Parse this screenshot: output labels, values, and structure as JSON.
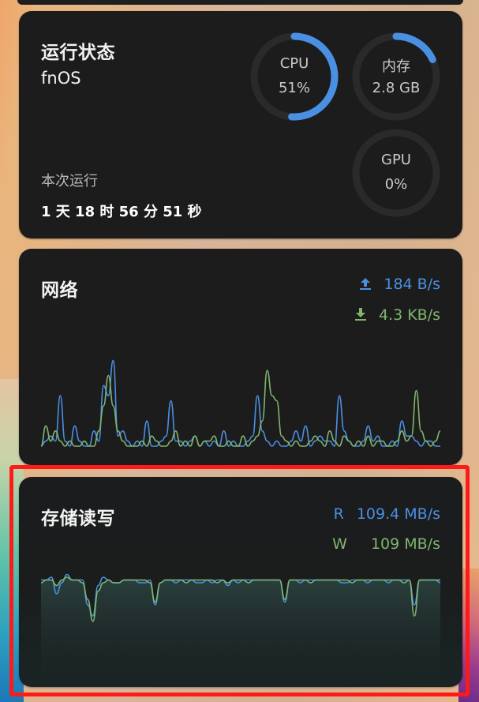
{
  "status_card": {
    "title": "运行状态",
    "os": "fnOS",
    "uptime_label": "本次运行",
    "uptime_value": "1 天 18 时 56 分 51 秒",
    "gauges": [
      {
        "label": "CPU",
        "value": "51%",
        "fraction": 0.51,
        "color": "#4a90e2"
      },
      {
        "label": "内存",
        "value": "2.8 GB",
        "fraction": 0.18,
        "color": "#4a90e2"
      },
      {
        "label": "GPU",
        "value": "0%",
        "fraction": 0.0,
        "color": "#4a90e2"
      }
    ]
  },
  "network_card": {
    "title": "网络",
    "upload": "184 B/s",
    "download": "4.3 KB/s",
    "upload_icon": "upload-arrow-icon",
    "download_icon": "download-arrow-icon",
    "colors": {
      "upload": "#4a90e2",
      "download": "#80b56e"
    }
  },
  "storage_card": {
    "title": "存储读写",
    "read_tag": "R",
    "read": "109.4 MB/s",
    "write_tag": "W",
    "write": "109 MB/s",
    "colors": {
      "read": "#4a90e2",
      "write": "#80b56e"
    }
  },
  "chart_data": [
    {
      "type": "line",
      "series": [
        {
          "values": [
            0,
            1,
            2,
            1,
            10,
            1,
            0,
            4,
            1,
            0,
            0,
            3,
            1,
            12,
            10,
            17,
            2,
            3,
            1,
            0,
            1,
            0,
            5,
            0,
            0,
            1,
            2,
            9,
            1,
            1,
            0,
            1,
            2,
            0,
            1,
            0,
            1,
            0,
            3,
            0,
            1,
            0,
            0,
            1,
            2,
            10,
            3,
            1,
            0,
            1,
            0,
            0,
            1,
            3,
            1,
            4,
            0,
            1,
            2,
            1,
            1,
            0,
            10,
            3,
            1,
            0,
            0,
            1,
            4,
            1,
            2,
            0,
            0,
            1,
            0,
            5,
            2,
            2,
            1,
            0,
            1,
            1,
            0,
            0
          ]
        },
        {
          "values": [
            0,
            4,
            1,
            3,
            1,
            0,
            1,
            0,
            0,
            1,
            0,
            0,
            3,
            8,
            14,
            8,
            3,
            1,
            0,
            0,
            0,
            1,
            0,
            2,
            1,
            0,
            0,
            1,
            3,
            0,
            1,
            0,
            2,
            0,
            1,
            1,
            2,
            0,
            0,
            1,
            0,
            0,
            2,
            0,
            1,
            2,
            5,
            15,
            10,
            9,
            2,
            1,
            0,
            1,
            0,
            0,
            1,
            2,
            1,
            0,
            3,
            1,
            0,
            2,
            1,
            0,
            1,
            0,
            2,
            0,
            1,
            1,
            0,
            0,
            1,
            3,
            1,
            2,
            11,
            3,
            1,
            0,
            1,
            3
          ]
        }
      ]
    },
    {
      "type": "area",
      "series": [
        {
          "values": [
            97,
            97,
            98,
            92,
            96,
            99,
            97,
            97,
            97,
            88,
            84,
            95,
            98,
            97,
            96,
            96,
            97,
            97,
            97,
            96,
            96,
            97,
            88,
            96,
            97,
            97,
            96,
            97,
            97,
            97,
            96,
            96,
            97,
            96,
            97,
            97,
            95,
            97,
            96,
            97,
            97,
            97,
            97,
            97,
            97,
            97,
            97,
            89,
            97,
            97,
            96,
            97,
            97,
            97,
            97,
            97,
            97,
            97,
            96,
            96,
            97,
            97,
            97,
            96,
            97,
            97,
            97,
            96,
            97,
            97,
            97,
            97,
            88,
            97,
            97,
            97,
            97,
            96
          ]
        },
        {
          "values": [
            96,
            97,
            97,
            95,
            97,
            98,
            97,
            97,
            96,
            90,
            82,
            93,
            96,
            97,
            96,
            96,
            97,
            97,
            97,
            97,
            97,
            96,
            89,
            96,
            97,
            97,
            97,
            97,
            96,
            97,
            97,
            97,
            97,
            97,
            96,
            97,
            96,
            97,
            97,
            97,
            96,
            97,
            97,
            97,
            97,
            97,
            97,
            90,
            97,
            97,
            97,
            97,
            96,
            97,
            97,
            97,
            97,
            97,
            97,
            97,
            96,
            97,
            97,
            97,
            97,
            97,
            97,
            97,
            97,
            97,
            96,
            97,
            84,
            97,
            97,
            97,
            97,
            97
          ]
        }
      ]
    }
  ]
}
